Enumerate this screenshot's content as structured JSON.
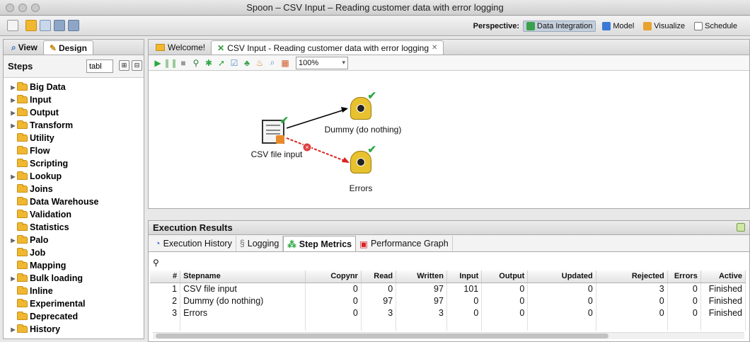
{
  "window": {
    "title": "Spoon – CSV Input – Reading customer data with error logging"
  },
  "perspective": {
    "label": "Perspective:",
    "items": [
      {
        "label": "Data Integration",
        "active": true,
        "icon": "data-integration-icon",
        "color": "#3aa14a"
      },
      {
        "label": "Model",
        "active": false,
        "icon": "model-icon",
        "color": "#3b78d8"
      },
      {
        "label": "Visualize",
        "active": false,
        "icon": "visualize-icon",
        "color": "#e8a230"
      },
      {
        "label": "Schedule",
        "active": false,
        "icon": "schedule-icon",
        "color": "#777777"
      }
    ]
  },
  "left": {
    "tabs": [
      {
        "label": "View",
        "icon": "view-icon"
      },
      {
        "label": "Design",
        "icon": "pencil-icon"
      }
    ],
    "steps_title": "Steps",
    "filter_value": "tabl",
    "tree": [
      {
        "label": "Big Data",
        "expandable": true
      },
      {
        "label": "Input",
        "expandable": true
      },
      {
        "label": "Output",
        "expandable": true
      },
      {
        "label": "Transform",
        "expandable": true
      },
      {
        "label": "Utility",
        "expandable": false
      },
      {
        "label": "Flow",
        "expandable": false
      },
      {
        "label": "Scripting",
        "expandable": false
      },
      {
        "label": "Lookup",
        "expandable": true
      },
      {
        "label": "Joins",
        "expandable": false
      },
      {
        "label": "Data Warehouse",
        "expandable": false
      },
      {
        "label": "Validation",
        "expandable": false
      },
      {
        "label": "Statistics",
        "expandable": false
      },
      {
        "label": "Palo",
        "expandable": true
      },
      {
        "label": "Job",
        "expandable": false
      },
      {
        "label": "Mapping",
        "expandable": false
      },
      {
        "label": "Bulk loading",
        "expandable": true
      },
      {
        "label": "Inline",
        "expandable": false
      },
      {
        "label": "Experimental",
        "expandable": false
      },
      {
        "label": "Deprecated",
        "expandable": false
      },
      {
        "label": "History",
        "expandable": true
      }
    ]
  },
  "editor": {
    "tabs": [
      {
        "label": "Welcome!",
        "active": false
      },
      {
        "label": "CSV Input - Reading customer data with error logging",
        "active": true,
        "close": "✕"
      }
    ],
    "zoom": "100%",
    "nodes": {
      "csv": "CSV file input",
      "dummy": "Dummy (do nothing)",
      "errors": "Errors"
    }
  },
  "results": {
    "title": "Execution Results",
    "tabs": [
      {
        "label": "Execution History",
        "active": false
      },
      {
        "label": "Logging",
        "active": false
      },
      {
        "label": "Step Metrics",
        "active": true
      },
      {
        "label": "Performance Graph",
        "active": false
      }
    ],
    "columns": [
      "#",
      "Stepname",
      "Copynr",
      "Read",
      "Written",
      "Input",
      "Output",
      "Updated",
      "Rejected",
      "Errors",
      "Active"
    ],
    "rows": [
      [
        "1",
        "CSV file input",
        "0",
        "0",
        "97",
        "101",
        "0",
        "0",
        "3",
        "0",
        "Finished"
      ],
      [
        "2",
        "Dummy (do nothing)",
        "0",
        "97",
        "97",
        "0",
        "0",
        "0",
        "0",
        "0",
        "Finished"
      ],
      [
        "3",
        "Errors",
        "0",
        "3",
        "3",
        "0",
        "0",
        "0",
        "0",
        "0",
        "Finished"
      ]
    ]
  }
}
